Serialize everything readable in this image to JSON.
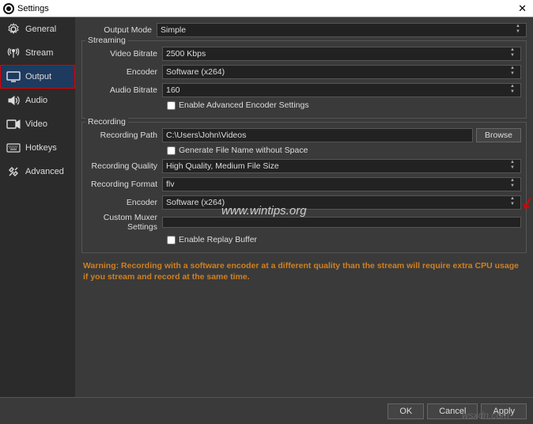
{
  "window": {
    "title": "Settings"
  },
  "sidebar": {
    "items": [
      {
        "label": "General"
      },
      {
        "label": "Stream"
      },
      {
        "label": "Output"
      },
      {
        "label": "Audio"
      },
      {
        "label": "Video"
      },
      {
        "label": "Hotkeys"
      },
      {
        "label": "Advanced"
      }
    ]
  },
  "outputMode": {
    "label": "Output Mode",
    "value": "Simple"
  },
  "streaming": {
    "title": "Streaming",
    "videoBitrate": {
      "label": "Video Bitrate",
      "value": "2500 Kbps"
    },
    "encoder": {
      "label": "Encoder",
      "value": "Software (x264)"
    },
    "audioBitrate": {
      "label": "Audio Bitrate",
      "value": "160"
    },
    "advancedEncoder": {
      "label": "Enable Advanced Encoder Settings"
    }
  },
  "recording": {
    "title": "Recording",
    "path": {
      "label": "Recording Path",
      "value": "C:\\Users\\John\\Videos",
      "browse": "Browse"
    },
    "noSpace": {
      "label": "Generate File Name without Space"
    },
    "quality": {
      "label": "Recording Quality",
      "value": "High Quality, Medium File Size"
    },
    "format": {
      "label": "Recording Format",
      "value": "flv"
    },
    "encoder": {
      "label": "Encoder",
      "value": "Software (x264)"
    },
    "muxer": {
      "label": "Custom Muxer Settings",
      "value": ""
    },
    "replayBuffer": {
      "label": "Enable Replay Buffer"
    }
  },
  "warning": "Warning: Recording with a software encoder at a different quality than the stream will require extra CPU usage if you stream and record at the same time.",
  "buttons": {
    "ok": "OK",
    "cancel": "Cancel",
    "apply": "Apply"
  },
  "watermark1": "www.wintips.org",
  "watermark2": "wsxdn.com"
}
